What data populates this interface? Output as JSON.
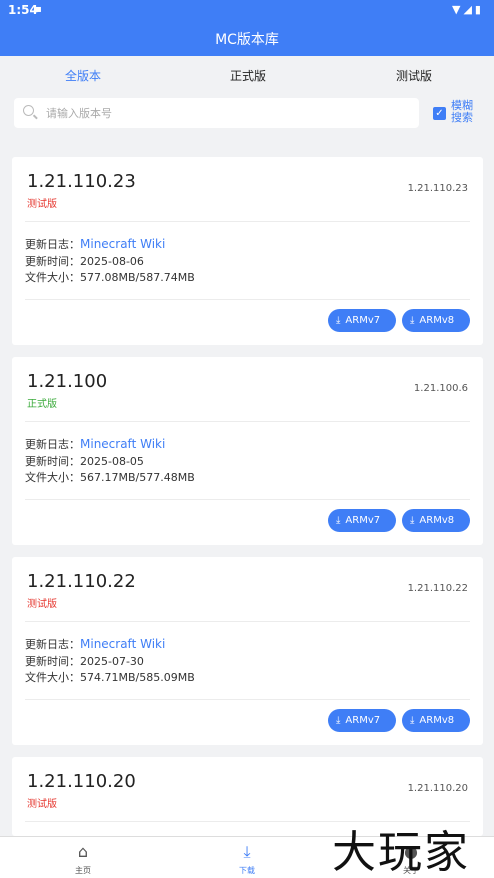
{
  "status_bar": {
    "time": "1:54",
    "left_icon": "android-notification-icon",
    "right_icons": "▼◢▮"
  },
  "app": {
    "title": "MC版本库"
  },
  "tabs": [
    {
      "label": "全版本",
      "active": true
    },
    {
      "label": "正式版",
      "active": false
    },
    {
      "label": "测试版",
      "active": false
    }
  ],
  "search": {
    "placeholder": "请输入版本号",
    "value": ""
  },
  "fuzzy_search": {
    "label": "模糊搜索",
    "checked": true
  },
  "labels": {
    "changelog": "更新日志：",
    "updated": "更新时间：",
    "size": "文件大小："
  },
  "cards": [
    {
      "version": "1.21.110.23",
      "channel": "测试版",
      "version_code": "1.21.110.23",
      "changelog": "Minecraft Wiki",
      "date": "2025-08-06",
      "size": "577.08MB/587.74MB",
      "buttons": [
        "ARMv7",
        "ARMv8"
      ]
    },
    {
      "version": "1.21.100",
      "channel": "正式版",
      "version_code": "1.21.100.6",
      "changelog": "Minecraft Wiki",
      "date": "2025-08-05",
      "size": "567.17MB/577.48MB",
      "buttons": [
        "ARMv7",
        "ARMv8"
      ]
    },
    {
      "version": "1.21.110.22",
      "channel": "测试版",
      "version_code": "1.21.110.22",
      "changelog": "Minecraft Wiki",
      "date": "2025-07-30",
      "size": "574.71MB/585.09MB",
      "buttons": [
        "ARMv7",
        "ARMv8"
      ]
    },
    {
      "version": "1.21.110.20",
      "channel": "测试版",
      "version_code": "1.21.110.20"
    }
  ],
  "bottom_nav": [
    {
      "label": "主页",
      "icon": "home-icon",
      "active": false
    },
    {
      "label": "下载",
      "icon": "download-icon",
      "active": true
    },
    {
      "label": "关于",
      "icon": "person-icon",
      "active": false
    }
  ],
  "watermark": "大玩家",
  "colors": {
    "primary": "#3f7ef6",
    "beta": "#e5372f",
    "release": "#3aaa3a",
    "background": "#f1f2f4"
  }
}
